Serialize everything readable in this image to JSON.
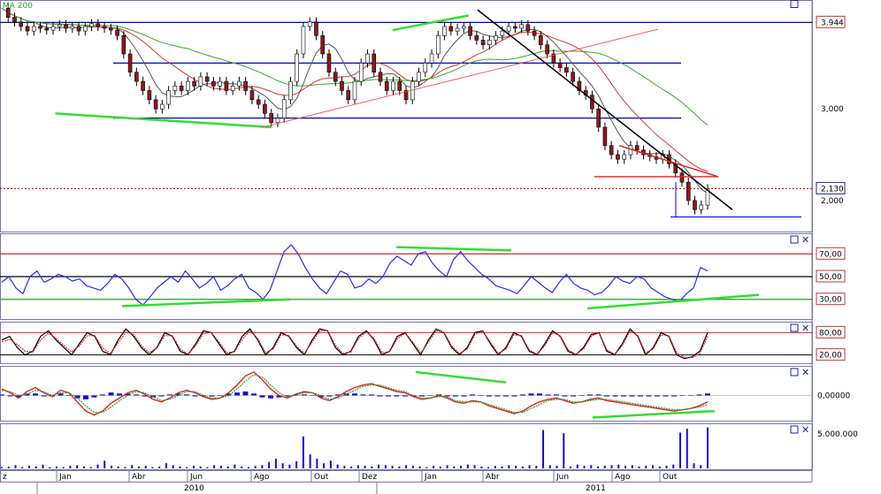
{
  "app": {
    "indicator_label": "MA 200",
    "indicator_color": "#2a9d2a"
  },
  "colors": {
    "price_up": "#ffffff",
    "price_down": "#8b1a1a",
    "price_wick": "#000000",
    "horizontal_level": "#0000cc",
    "trendline_black": "#000000",
    "trend_green": "#33dd33",
    "support_red": "#ff4444",
    "triangle_red": "#e02020",
    "dotted_red": "#cc0000",
    "rsi_line": "#2a2aee",
    "volume_bar": "#1010cc",
    "macd_hist": "#1010cc",
    "osc_black": "#000000",
    "osc_red": "#dd2222",
    "sma_grey": "#555555",
    "sma_red": "#dd3333",
    "sma_green": "#33aa33",
    "panel_border": "#7777aa",
    "label_box_border": "#cc3333"
  },
  "icons": {
    "maximize": "square-icon",
    "close": "close-x-icon"
  },
  "chart_data": [
    {
      "panel": "price",
      "type": "line",
      "series_label": "MA 200",
      "y_ticks": [
        "3,944",
        "3,000",
        "2,130",
        "2,000"
      ],
      "current_value": "2,130",
      "horizontal_levels": [
        3.944,
        3.5,
        2.9
      ],
      "x_ticks": [
        "z",
        "Jan",
        "Abr",
        "Jun",
        "Ago",
        "Out",
        "Dez",
        "Jan",
        "Abr",
        "Jun",
        "Ago",
        "Out"
      ],
      "x_years": [
        "2010",
        "2011"
      ],
      "close": [
        4.1,
        4.0,
        3.95,
        3.9,
        3.85,
        3.9,
        3.88,
        3.86,
        3.9,
        3.92,
        3.88,
        3.9,
        3.85,
        3.9,
        3.93,
        3.9,
        3.88,
        3.86,
        3.8,
        3.6,
        3.4,
        3.3,
        3.2,
        3.1,
        3.0,
        3.05,
        3.2,
        3.25,
        3.2,
        3.3,
        3.25,
        3.35,
        3.3,
        3.25,
        3.3,
        3.2,
        3.25,
        3.3,
        3.2,
        3.1,
        3.05,
        2.95,
        2.85,
        2.9,
        3.1,
        3.3,
        3.6,
        3.9,
        3.95,
        3.8,
        3.6,
        3.4,
        3.3,
        3.2,
        3.1,
        3.3,
        3.5,
        3.6,
        3.4,
        3.3,
        3.2,
        3.3,
        3.2,
        3.1,
        3.3,
        3.4,
        3.5,
        3.6,
        3.8,
        3.9,
        3.85,
        3.88,
        3.9,
        3.8,
        3.75,
        3.7,
        3.75,
        3.8,
        3.85,
        3.9,
        3.88,
        3.92,
        3.85,
        3.8,
        3.7,
        3.6,
        3.5,
        3.45,
        3.4,
        3.3,
        3.2,
        3.15,
        3.0,
        2.8,
        2.6,
        2.5,
        2.45,
        2.5,
        2.6,
        2.55,
        2.5,
        2.48,
        2.45,
        2.5,
        2.4,
        2.3,
        2.2,
        2.0,
        1.9,
        1.95,
        2.13
      ]
    },
    {
      "panel": "rsi",
      "type": "line",
      "y_ticks": [
        "70,00",
        "50,00",
        "30,00"
      ],
      "levels": [
        70,
        50,
        30
      ],
      "values": [
        45,
        50,
        40,
        35,
        50,
        55,
        45,
        48,
        52,
        50,
        46,
        48,
        42,
        40,
        38,
        44,
        52,
        48,
        40,
        30,
        25,
        32,
        40,
        45,
        50,
        45,
        55,
        48,
        40,
        44,
        50,
        38,
        42,
        48,
        52,
        40,
        36,
        30,
        38,
        55,
        72,
        78,
        70,
        58,
        48,
        40,
        35,
        45,
        55,
        52,
        40,
        42,
        48,
        44,
        50,
        62,
        68,
        64,
        60,
        70,
        72,
        62,
        55,
        50,
        65,
        72,
        64,
        58,
        52,
        48,
        42,
        40,
        38,
        35,
        42,
        50,
        45,
        40,
        36,
        45,
        52,
        44,
        40,
        38,
        34,
        36,
        42,
        50,
        46,
        44,
        50,
        48,
        40,
        36,
        32,
        30,
        28,
        35,
        40,
        58,
        55
      ]
    },
    {
      "panel": "stochastic",
      "type": "line",
      "y_ticks": [
        "80,00",
        "20,00"
      ],
      "levels": [
        80,
        20
      ],
      "k": [
        60,
        70,
        40,
        20,
        30,
        70,
        85,
        60,
        40,
        20,
        50,
        80,
        70,
        30,
        20,
        60,
        90,
        70,
        40,
        20,
        40,
        80,
        70,
        30,
        20,
        50,
        85,
        80,
        50,
        20,
        30,
        70,
        90,
        60,
        20,
        40,
        80,
        70,
        40,
        20,
        60,
        90,
        85,
        40,
        20,
        30,
        70,
        85,
        60,
        20,
        30,
        70,
        80,
        50,
        20,
        60,
        90,
        80,
        40,
        20,
        40,
        80,
        85,
        50,
        20,
        40,
        80,
        70,
        30,
        20,
        50,
        85,
        70,
        30,
        20,
        40,
        75,
        80,
        30,
        20,
        50,
        90,
        70,
        20,
        40,
        80,
        70,
        20,
        10,
        15,
        30,
        80
      ],
      "d": [
        55,
        62,
        48,
        30,
        28,
        60,
        78,
        65,
        45,
        28,
        44,
        72,
        72,
        38,
        24,
        52,
        82,
        75,
        45,
        26,
        38,
        72,
        72,
        36,
        22,
        45,
        78,
        80,
        55,
        26,
        28,
        62,
        85,
        64,
        26,
        36,
        74,
        72,
        44,
        24,
        54,
        85,
        86,
        46,
        24,
        28,
        64,
        82,
        64,
        26,
        28,
        64,
        78,
        54,
        24,
        54,
        85,
        82,
        44,
        24,
        36,
        74,
        84,
        54,
        24,
        36,
        74,
        72,
        34,
        22,
        44,
        80,
        72,
        34,
        22,
        36,
        70,
        80,
        34,
        22,
        44,
        85,
        72,
        26,
        36,
        74,
        72,
        26,
        14,
        12,
        24,
        70
      ]
    },
    {
      "panel": "macd",
      "type": "line",
      "y_ticks": [
        "0,00000"
      ],
      "macd": [
        0.05,
        0.02,
        -0.02,
        0.03,
        0.06,
        0.02,
        -0.01,
        0.04,
        0.02,
        -0.05,
        -0.12,
        -0.15,
        -0.12,
        -0.06,
        -0.02,
        0.02,
        0.04,
        0.01,
        -0.03,
        -0.05,
        -0.02,
        0.02,
        0.04,
        0.02,
        -0.01,
        -0.03,
        -0.02,
        0.02,
        0.08,
        0.15,
        0.18,
        0.12,
        0.05,
        0.0,
        -0.02,
        0.01,
        0.03,
        0.02,
        -0.02,
        -0.04,
        -0.01,
        0.03,
        0.06,
        0.08,
        0.09,
        0.07,
        0.05,
        0.03,
        0.02,
        -0.01,
        -0.03,
        -0.02,
        0.0,
        -0.02,
        -0.05,
        -0.06,
        -0.04,
        -0.05,
        -0.08,
        -0.1,
        -0.12,
        -0.14,
        -0.12,
        -0.08,
        -0.05,
        -0.03,
        -0.02,
        -0.04,
        -0.06,
        -0.05,
        -0.03,
        -0.02,
        -0.04,
        -0.05,
        -0.06,
        -0.07,
        -0.08,
        -0.09,
        -0.1,
        -0.11,
        -0.12,
        -0.11,
        -0.1,
        -0.08,
        -0.05
      ],
      "signal": [
        0.04,
        0.03,
        0.0,
        0.01,
        0.04,
        0.03,
        0.0,
        0.02,
        0.02,
        -0.02,
        -0.08,
        -0.13,
        -0.13,
        -0.09,
        -0.04,
        0.0,
        0.03,
        0.02,
        -0.01,
        -0.04,
        -0.03,
        0.0,
        0.03,
        0.03,
        0.0,
        -0.02,
        -0.02,
        0.0,
        0.05,
        0.11,
        0.16,
        0.14,
        0.08,
        0.02,
        -0.01,
        0.0,
        0.02,
        0.02,
        0.0,
        -0.03,
        -0.02,
        0.01,
        0.04,
        0.07,
        0.08,
        0.08,
        0.06,
        0.04,
        0.03,
        0.0,
        -0.02,
        -0.02,
        -0.01,
        -0.01,
        -0.04,
        -0.05,
        -0.05,
        -0.05,
        -0.07,
        -0.09,
        -0.11,
        -0.13,
        -0.13,
        -0.1,
        -0.07,
        -0.04,
        -0.03,
        -0.03,
        -0.05,
        -0.05,
        -0.04,
        -0.03,
        -0.03,
        -0.04,
        -0.05,
        -0.06,
        -0.07,
        -0.08,
        -0.09,
        -0.1,
        -0.11,
        -0.11,
        -0.1,
        -0.09,
        -0.07
      ]
    },
    {
      "panel": "volume",
      "type": "bar",
      "y_ticks": [
        "5.000.000"
      ],
      "values": [
        0.2,
        0.3,
        0.5,
        0.2,
        0.4,
        0.3,
        0.6,
        0.2,
        0.3,
        0.2,
        0.4,
        0.5,
        0.3,
        0.2,
        0.6,
        1.2,
        0.4,
        0.3,
        0.2,
        0.5,
        0.3,
        0.4,
        0.2,
        0.3,
        0.8,
        0.5,
        0.3,
        0.2,
        0.4,
        0.3,
        0.2,
        0.5,
        0.4,
        0.3,
        0.6,
        0.3,
        0.2,
        0.4,
        0.5,
        1.0,
        1.5,
        0.8,
        0.6,
        1.1,
        5.0,
        2.2,
        1.5,
        0.8,
        1.2,
        0.6,
        0.4,
        0.3,
        0.5,
        0.4,
        0.3,
        0.6,
        0.5,
        0.4,
        0.3,
        0.5,
        0.4,
        0.3,
        0.2,
        0.4,
        0.3,
        0.5,
        0.3,
        0.4,
        0.6,
        0.5,
        0.3,
        0.2,
        0.4,
        0.3,
        0.5,
        0.4,
        0.3,
        0.5,
        0.4,
        6.0,
        0.5,
        0.4,
        5.5,
        0.3,
        0.6,
        0.4,
        0.5,
        0.3,
        0.4,
        0.5,
        0.6,
        0.4,
        0.5,
        0.3,
        0.4,
        0.5,
        0.3,
        0.4,
        0.6,
        5.6,
        6.2,
        0.8,
        0.5,
        6.4
      ]
    }
  ]
}
